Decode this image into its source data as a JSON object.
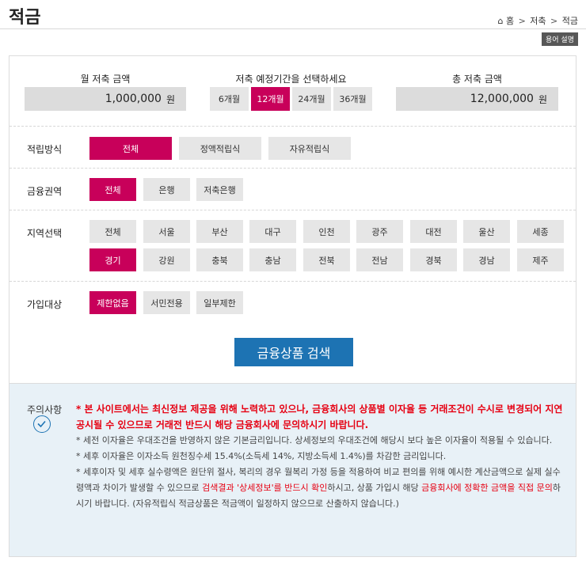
{
  "header": {
    "title": "적금",
    "breadcrumb": [
      "홈",
      "저축",
      "적금"
    ],
    "term_button": "용어 설명"
  },
  "summary": {
    "monthly_label": "월 저축 금액",
    "monthly_value": "1,000,000",
    "unit": "원",
    "period_label": "저축 예정기간을 선택하세요",
    "periods": [
      "6개월",
      "12개월",
      "24개월",
      "36개월"
    ],
    "selected_period": "12개월",
    "total_label": "총 저축 금액",
    "total_value": "12,000,000"
  },
  "filters": {
    "method": {
      "label": "적립방식",
      "options": [
        "전체",
        "정액적립식",
        "자유적립식"
      ],
      "selected": "전체"
    },
    "sector": {
      "label": "금융권역",
      "options": [
        "전체",
        "은행",
        "저축은행"
      ],
      "selected": "전체"
    },
    "region": {
      "label": "지역선택",
      "options": [
        "전체",
        "서울",
        "부산",
        "대구",
        "인천",
        "광주",
        "대전",
        "울산",
        "세종",
        "경기",
        "강원",
        "충북",
        "충남",
        "전북",
        "전남",
        "경북",
        "경남",
        "제주"
      ],
      "selected": "경기"
    },
    "target": {
      "label": "가입대상",
      "options": [
        "제한없음",
        "서민전용",
        "일부제한"
      ],
      "selected": "제한없음"
    }
  },
  "search_button": "금융상품 검색",
  "notice": {
    "label": "주의사항",
    "warning": "* 본 사이트에서는 최신정보 제공을 위해 노력하고 있으나, 금융회사의 상품별 이자율 등 거래조건이 수시로 변경되어 지연공시될 수 있으므로 거래전 반드시 해당 금융회사에 문의하시기 바랍니다.",
    "line1": "* 세전 이자율은 우대조건을 반영하지 않은 기본금리입니다. 상세정보의 우대조건에 해당시 보다 높은 이자율이 적용될 수 있습니다.",
    "line2": "* 세후 이자율은 이자소득 원천징수세 15.4%(소득세 14%, 지방소득세 1.4%)를 차감한 금리입니다.",
    "line3_a": "* 세후이자 및 세후 실수령액은 원단위 절사, 복리의 경우 월복리 가정 등을 적용하여 비교 편의를 위해 예시한 계산금액으로 실제 실수령액과 차이가 발생할 수 있으므로 ",
    "line3_red1": "검색결과 '상세정보'를 반드시 확인",
    "line3_b": "하시고, 상품 가입시 해당 ",
    "line3_red2": "금융회사에 정확한 금액을 직접 문의",
    "line3_c": "하시기 바랍니다. (자유적립식 적금상품은 적금액이 일정하지 않으므로 산출하지 않습니다.)"
  },
  "colors": {
    "accent": "#c8005a",
    "button_blue": "#1d73b3",
    "warning_red": "#e60012",
    "notice_bg": "#e8f1f7"
  }
}
